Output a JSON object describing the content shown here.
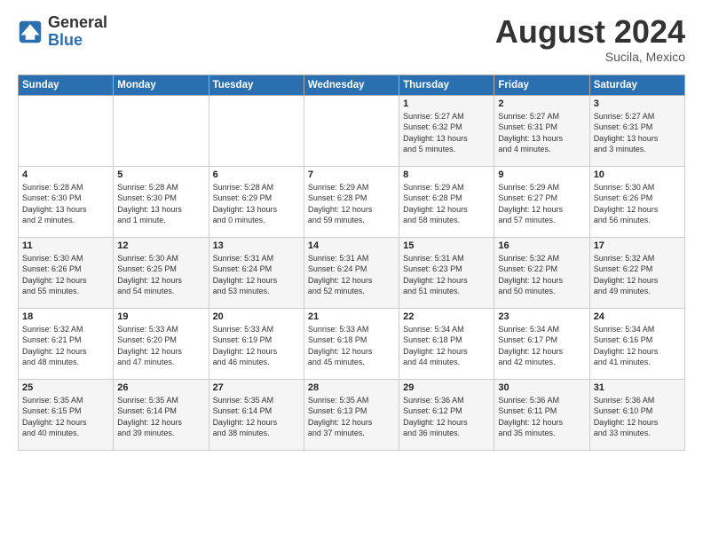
{
  "logo": {
    "general": "General",
    "blue": "Blue"
  },
  "title": "August 2024",
  "location": "Sucila, Mexico",
  "days_of_week": [
    "Sunday",
    "Monday",
    "Tuesday",
    "Wednesday",
    "Thursday",
    "Friday",
    "Saturday"
  ],
  "weeks": [
    [
      {
        "day": "",
        "info": ""
      },
      {
        "day": "",
        "info": ""
      },
      {
        "day": "",
        "info": ""
      },
      {
        "day": "",
        "info": ""
      },
      {
        "day": "1",
        "info": "Sunrise: 5:27 AM\nSunset: 6:32 PM\nDaylight: 13 hours\nand 5 minutes."
      },
      {
        "day": "2",
        "info": "Sunrise: 5:27 AM\nSunset: 6:31 PM\nDaylight: 13 hours\nand 4 minutes."
      },
      {
        "day": "3",
        "info": "Sunrise: 5:27 AM\nSunset: 6:31 PM\nDaylight: 13 hours\nand 3 minutes."
      }
    ],
    [
      {
        "day": "4",
        "info": "Sunrise: 5:28 AM\nSunset: 6:30 PM\nDaylight: 13 hours\nand 2 minutes."
      },
      {
        "day": "5",
        "info": "Sunrise: 5:28 AM\nSunset: 6:30 PM\nDaylight: 13 hours\nand 1 minute."
      },
      {
        "day": "6",
        "info": "Sunrise: 5:28 AM\nSunset: 6:29 PM\nDaylight: 13 hours\nand 0 minutes."
      },
      {
        "day": "7",
        "info": "Sunrise: 5:29 AM\nSunset: 6:28 PM\nDaylight: 12 hours\nand 59 minutes."
      },
      {
        "day": "8",
        "info": "Sunrise: 5:29 AM\nSunset: 6:28 PM\nDaylight: 12 hours\nand 58 minutes."
      },
      {
        "day": "9",
        "info": "Sunrise: 5:29 AM\nSunset: 6:27 PM\nDaylight: 12 hours\nand 57 minutes."
      },
      {
        "day": "10",
        "info": "Sunrise: 5:30 AM\nSunset: 6:26 PM\nDaylight: 12 hours\nand 56 minutes."
      }
    ],
    [
      {
        "day": "11",
        "info": "Sunrise: 5:30 AM\nSunset: 6:26 PM\nDaylight: 12 hours\nand 55 minutes."
      },
      {
        "day": "12",
        "info": "Sunrise: 5:30 AM\nSunset: 6:25 PM\nDaylight: 12 hours\nand 54 minutes."
      },
      {
        "day": "13",
        "info": "Sunrise: 5:31 AM\nSunset: 6:24 PM\nDaylight: 12 hours\nand 53 minutes."
      },
      {
        "day": "14",
        "info": "Sunrise: 5:31 AM\nSunset: 6:24 PM\nDaylight: 12 hours\nand 52 minutes."
      },
      {
        "day": "15",
        "info": "Sunrise: 5:31 AM\nSunset: 6:23 PM\nDaylight: 12 hours\nand 51 minutes."
      },
      {
        "day": "16",
        "info": "Sunrise: 5:32 AM\nSunset: 6:22 PM\nDaylight: 12 hours\nand 50 minutes."
      },
      {
        "day": "17",
        "info": "Sunrise: 5:32 AM\nSunset: 6:22 PM\nDaylight: 12 hours\nand 49 minutes."
      }
    ],
    [
      {
        "day": "18",
        "info": "Sunrise: 5:32 AM\nSunset: 6:21 PM\nDaylight: 12 hours\nand 48 minutes."
      },
      {
        "day": "19",
        "info": "Sunrise: 5:33 AM\nSunset: 6:20 PM\nDaylight: 12 hours\nand 47 minutes."
      },
      {
        "day": "20",
        "info": "Sunrise: 5:33 AM\nSunset: 6:19 PM\nDaylight: 12 hours\nand 46 minutes."
      },
      {
        "day": "21",
        "info": "Sunrise: 5:33 AM\nSunset: 6:18 PM\nDaylight: 12 hours\nand 45 minutes."
      },
      {
        "day": "22",
        "info": "Sunrise: 5:34 AM\nSunset: 6:18 PM\nDaylight: 12 hours\nand 44 minutes."
      },
      {
        "day": "23",
        "info": "Sunrise: 5:34 AM\nSunset: 6:17 PM\nDaylight: 12 hours\nand 42 minutes."
      },
      {
        "day": "24",
        "info": "Sunrise: 5:34 AM\nSunset: 6:16 PM\nDaylight: 12 hours\nand 41 minutes."
      }
    ],
    [
      {
        "day": "25",
        "info": "Sunrise: 5:35 AM\nSunset: 6:15 PM\nDaylight: 12 hours\nand 40 minutes."
      },
      {
        "day": "26",
        "info": "Sunrise: 5:35 AM\nSunset: 6:14 PM\nDaylight: 12 hours\nand 39 minutes."
      },
      {
        "day": "27",
        "info": "Sunrise: 5:35 AM\nSunset: 6:14 PM\nDaylight: 12 hours\nand 38 minutes."
      },
      {
        "day": "28",
        "info": "Sunrise: 5:35 AM\nSunset: 6:13 PM\nDaylight: 12 hours\nand 37 minutes."
      },
      {
        "day": "29",
        "info": "Sunrise: 5:36 AM\nSunset: 6:12 PM\nDaylight: 12 hours\nand 36 minutes."
      },
      {
        "day": "30",
        "info": "Sunrise: 5:36 AM\nSunset: 6:11 PM\nDaylight: 12 hours\nand 35 minutes."
      },
      {
        "day": "31",
        "info": "Sunrise: 5:36 AM\nSunset: 6:10 PM\nDaylight: 12 hours\nand 33 minutes."
      }
    ]
  ]
}
